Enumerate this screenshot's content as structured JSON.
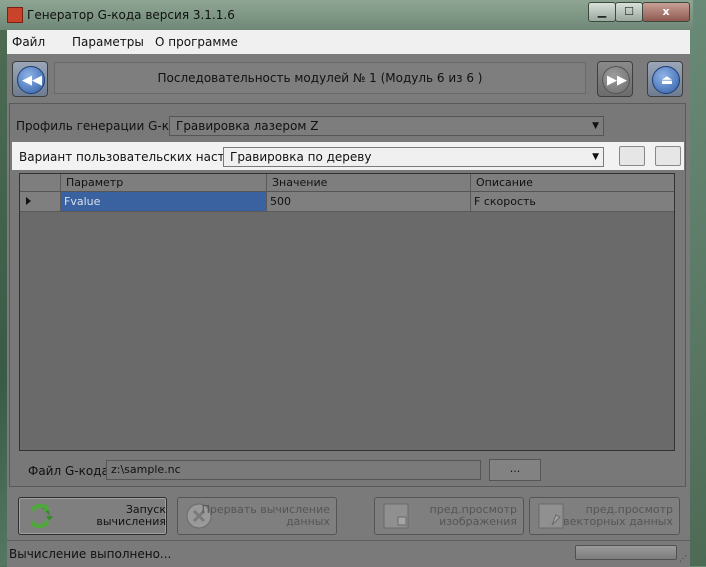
{
  "window": {
    "title": "Генератор G-кода версия 3.1.1.6",
    "close_glyph": "x"
  },
  "menu": [
    {
      "label": "Файл"
    },
    {
      "label": "Параметры"
    },
    {
      "label": "О программе"
    }
  ],
  "nav": {
    "sequence_text": "Последовательность модулей № 1 (Модуль 6 из 6 )",
    "back_icon": "rewind-icon",
    "forward_icon": "fast-forward-icon",
    "eject_icon": "eject-icon"
  },
  "profile": {
    "label": "Профиль генерации G-кода:",
    "value": "Гравировка лазером Z"
  },
  "variant": {
    "label": "Вариант пользовательских настроек:",
    "value": "Гравировка по дереву"
  },
  "grid": {
    "columns": [
      "Параметр",
      "Значение",
      "Описание"
    ],
    "rows": [
      {
        "param": "Fvalue",
        "value": "500",
        "desc": "F скорость"
      }
    ]
  },
  "gcode_file": {
    "label": "Файл G-кода:",
    "value": "z:\\sample.nc",
    "browse_label": "..."
  },
  "actions": {
    "run": {
      "line1": "Запуск вычисления",
      "line2": "",
      "icon": "refresh-icon"
    },
    "abort": {
      "line1": "Прервать вычисление",
      "line2": "данных",
      "icon": "stop-icon"
    },
    "preview_image": {
      "line1": "пред.просмотр",
      "line2": "изображения",
      "icon": "image-preview-icon"
    },
    "preview_vector": {
      "line1": "пред.просмотр",
      "line2": "векторных данных",
      "icon": "vector-preview-icon"
    }
  },
  "status": {
    "text": "Вычисление выполнено...",
    "progress": 1.0
  }
}
